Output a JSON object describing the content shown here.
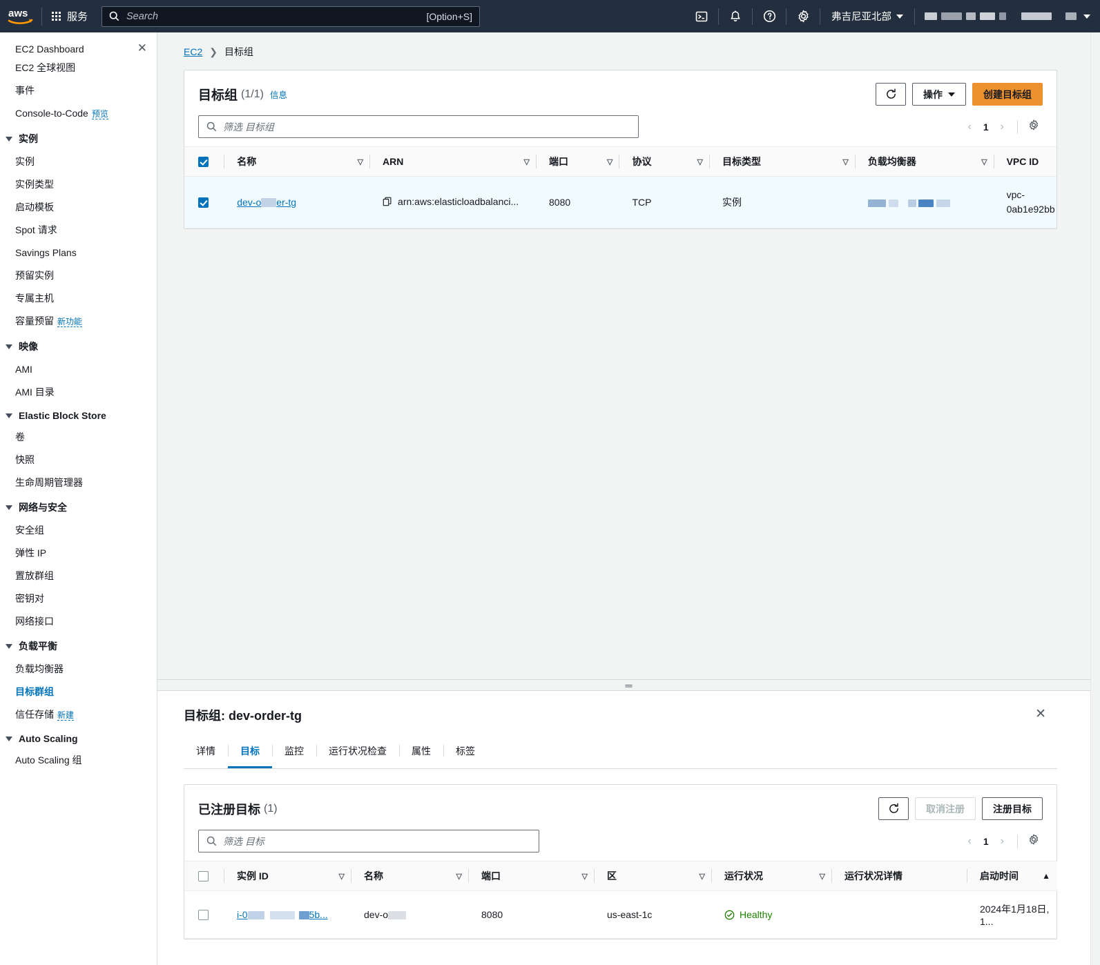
{
  "topnav": {
    "logo": "aws-logo",
    "services_label": "服务",
    "search": {
      "placeholder": "Search",
      "shortcut": "[Option+S]"
    },
    "icons": [
      "cloudshell-icon",
      "notifications-bell-icon",
      "help-question-icon",
      "settings-gear-icon"
    ],
    "region": "弗吉尼亚北部",
    "account_redacted": true
  },
  "sidebar": {
    "header": {
      "label": "EC2 Dashboard",
      "close": "close-icon"
    },
    "top_items": [
      {
        "label": "EC2 全球视图"
      },
      {
        "label": "事件"
      },
      {
        "label": "Console-to-Code",
        "badge": "预览"
      }
    ],
    "groups": [
      {
        "title": "实例",
        "items": [
          {
            "label": "实例"
          },
          {
            "label": "实例类型"
          },
          {
            "label": "启动模板"
          },
          {
            "label": "Spot 请求"
          },
          {
            "label": "Savings Plans"
          },
          {
            "label": "预留实例"
          },
          {
            "label": "专属主机"
          },
          {
            "label": "容量预留",
            "badge": "新功能"
          }
        ]
      },
      {
        "title": "映像",
        "items": [
          {
            "label": "AMI"
          },
          {
            "label": "AMI 目录"
          }
        ]
      },
      {
        "title": "Elastic Block Store",
        "items": [
          {
            "label": "卷"
          },
          {
            "label": "快照"
          },
          {
            "label": "生命周期管理器"
          }
        ]
      },
      {
        "title": "网络与安全",
        "items": [
          {
            "label": "安全组"
          },
          {
            "label": "弹性 IP"
          },
          {
            "label": "置放群组"
          },
          {
            "label": "密钥对"
          },
          {
            "label": "网络接口"
          }
        ]
      },
      {
        "title": "负载平衡",
        "items": [
          {
            "label": "负载均衡器"
          },
          {
            "label": "目标群组",
            "active": true
          },
          {
            "label": "信任存储",
            "badge": "新建"
          }
        ]
      },
      {
        "title": "Auto Scaling",
        "items": [
          {
            "label": "Auto Scaling 组"
          }
        ]
      }
    ]
  },
  "breadcrumb": {
    "root": "EC2",
    "current": "目标组"
  },
  "main_card": {
    "title": "目标组",
    "count": "(1/1)",
    "info_link": "信息",
    "refresh_icon": "refresh-icon",
    "actions_label": "操作",
    "create_label": "创建目标组",
    "filter_placeholder": "筛选 目标组",
    "page_number": "1",
    "settings_icon": "settings-gear-icon",
    "columns": [
      "名称",
      "ARN",
      "端口",
      "协议",
      "目标类型",
      "负载均衡器",
      "VPC ID"
    ],
    "rows": [
      {
        "selected": true,
        "name": "dev-order-tg",
        "name_redacted": true,
        "arn": "arn:aws:elasticloadbalanci...",
        "port": "8080",
        "protocol": "TCP",
        "target_type": "实例",
        "load_balancer_redacted": true,
        "vpc_id": "vpc-0ab1e92bb"
      }
    ]
  },
  "bottom_panel": {
    "title": "目标组: dev-order-tg",
    "close_icon": "close-icon",
    "tabs": [
      {
        "label": "详情",
        "active": false
      },
      {
        "label": "目标",
        "active": true
      },
      {
        "label": "监控",
        "active": false
      },
      {
        "label": "运行状况检查",
        "active": false
      },
      {
        "label": "属性",
        "active": false
      },
      {
        "label": "标签",
        "active": false
      }
    ],
    "table_card": {
      "title": "已注册目标",
      "count": "(1)",
      "refresh_icon": "refresh-icon",
      "deregister_label": "取消注册",
      "register_label": "注册目标",
      "filter_placeholder": "筛选 目标",
      "page_number": "1",
      "settings_icon": "settings-gear-icon",
      "columns": [
        "实例 ID",
        "名称",
        "端口",
        "区",
        "运行状况",
        "运行状况详情",
        "启动时间"
      ],
      "rows": [
        {
          "instance_id": "i-0",
          "instance_id_suffix": "5b...",
          "instance_id_redacted": true,
          "name": "dev-o",
          "name_redacted": true,
          "port": "8080",
          "zone": "us-east-1c",
          "health": "Healthy",
          "health_icon": "check-circle-icon",
          "health_details": "",
          "launch_time": "2024年1月18日, 1..."
        }
      ]
    }
  },
  "colors": {
    "nav_bg": "#232f3e",
    "accent_blue": "#0073bb",
    "primary_orange": "#ec912d",
    "healthy_green": "#1d8102",
    "selected_row": "#f1faff"
  }
}
